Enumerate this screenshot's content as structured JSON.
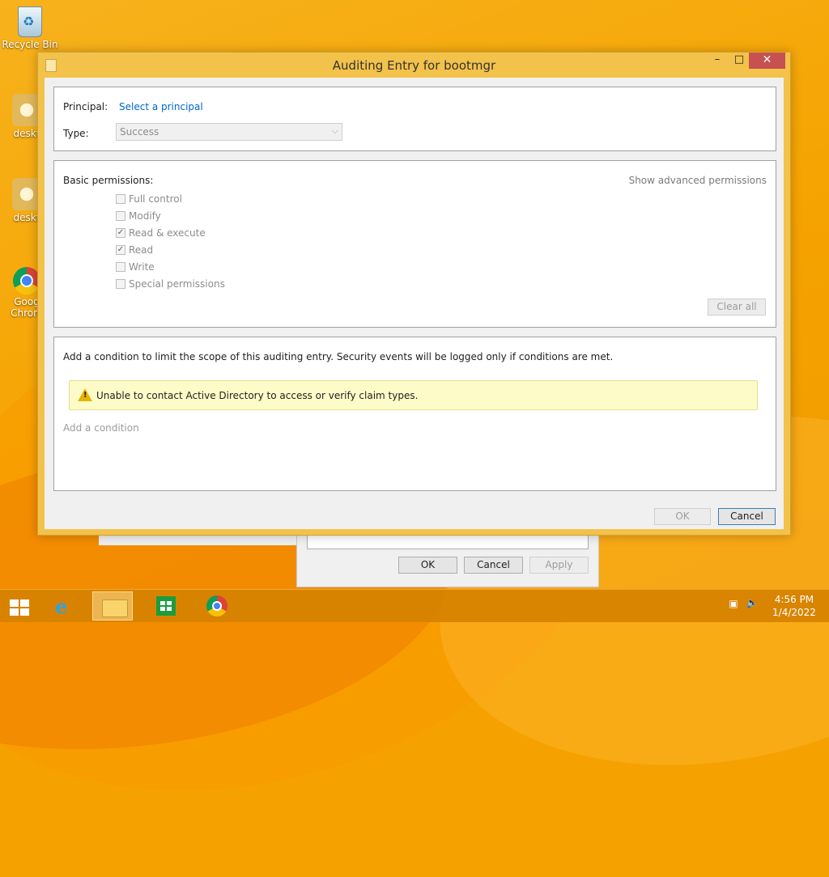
{
  "desktop": {
    "icons": [
      {
        "label": "Recycle Bin",
        "icon": "recycle-bin-icon"
      },
      {
        "label": "deskt",
        "icon": "settings-file-icon"
      },
      {
        "label": "deskt",
        "icon": "settings-file-icon"
      },
      {
        "label": "Goog Chrom",
        "icon": "chrome-icon"
      }
    ]
  },
  "background_dialog": {
    "ok_label": "OK",
    "cancel_label": "Cancel",
    "apply_label": "Apply"
  },
  "window": {
    "title": "Auditing Entry for bootmgr",
    "minimize_glyph": "–",
    "maximize_glyph": "□",
    "close_glyph": "✕"
  },
  "principal_section": {
    "principal_label": "Principal:",
    "principal_link": "Select a principal",
    "type_label": "Type:",
    "type_value": "Success"
  },
  "permissions_section": {
    "title": "Basic permissions:",
    "advanced_link": "Show advanced permissions",
    "items": [
      {
        "label": "Full control",
        "checked": false
      },
      {
        "label": "Modify",
        "checked": false
      },
      {
        "label": "Read & execute",
        "checked": true
      },
      {
        "label": "Read",
        "checked": true
      },
      {
        "label": "Write",
        "checked": false
      },
      {
        "label": "Special permissions",
        "checked": false
      }
    ],
    "clear_all_label": "Clear all"
  },
  "condition_section": {
    "description": "Add a condition to limit the scope of this auditing entry. Security events will be logged only if conditions are met.",
    "warning_text": "Unable to contact Active Directory to access or verify claim types.",
    "add_condition_label": "Add a condition"
  },
  "footer": {
    "ok_label": "OK",
    "cancel_label": "Cancel"
  },
  "taskbar": {
    "items": [
      "start-button",
      "internet-explorer",
      "file-explorer",
      "store",
      "chrome"
    ],
    "clock_time": "4:56 PM",
    "clock_date": "1/4/2022"
  },
  "colors": {
    "desktop": "#f5a300",
    "window_frame": "#f3c24a",
    "close_button": "#c75050",
    "link": "#0066cc",
    "warning_bg": "#fdfcc8"
  }
}
